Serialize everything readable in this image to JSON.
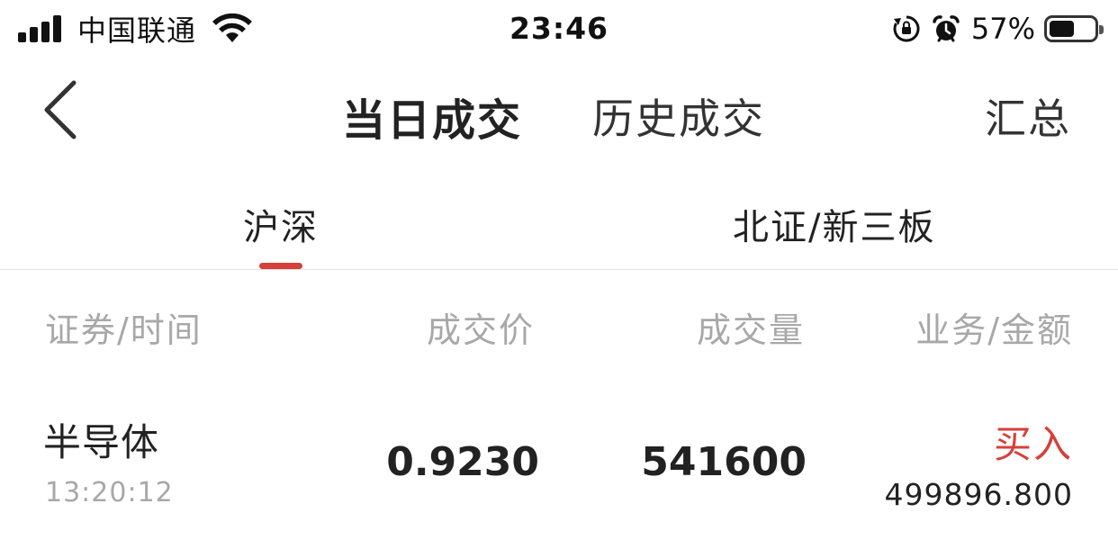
{
  "status_bar": {
    "carrier": "中国联通",
    "time": "23:46",
    "battery_percent": "57%",
    "battery_level": 0.57,
    "icons": [
      "signal-icon",
      "wifi-icon",
      "orientation-lock-icon",
      "alarm-icon",
      "battery-icon"
    ]
  },
  "nav": {
    "back_icon": "chevron-left-icon",
    "tab_today": "当日成交",
    "tab_history": "历史成交",
    "summary": "汇总"
  },
  "market_tabs": {
    "tab_1": "沪深",
    "tab_2": "北证/新三板",
    "active": "沪深",
    "indicator_color": "#d6403a"
  },
  "table": {
    "headers": [
      "证券/时间",
      "成交价",
      "成交量",
      "业务/金额"
    ],
    "rows": [
      {
        "name": "半导体",
        "time": "13:20:12",
        "price": "0.9230",
        "volume": "541600",
        "action": "买入",
        "amount": "499896.800"
      }
    ]
  },
  "colors": {
    "accent_red": "#d6403a",
    "text_primary": "#222222",
    "text_secondary": "#a8a8a8"
  }
}
